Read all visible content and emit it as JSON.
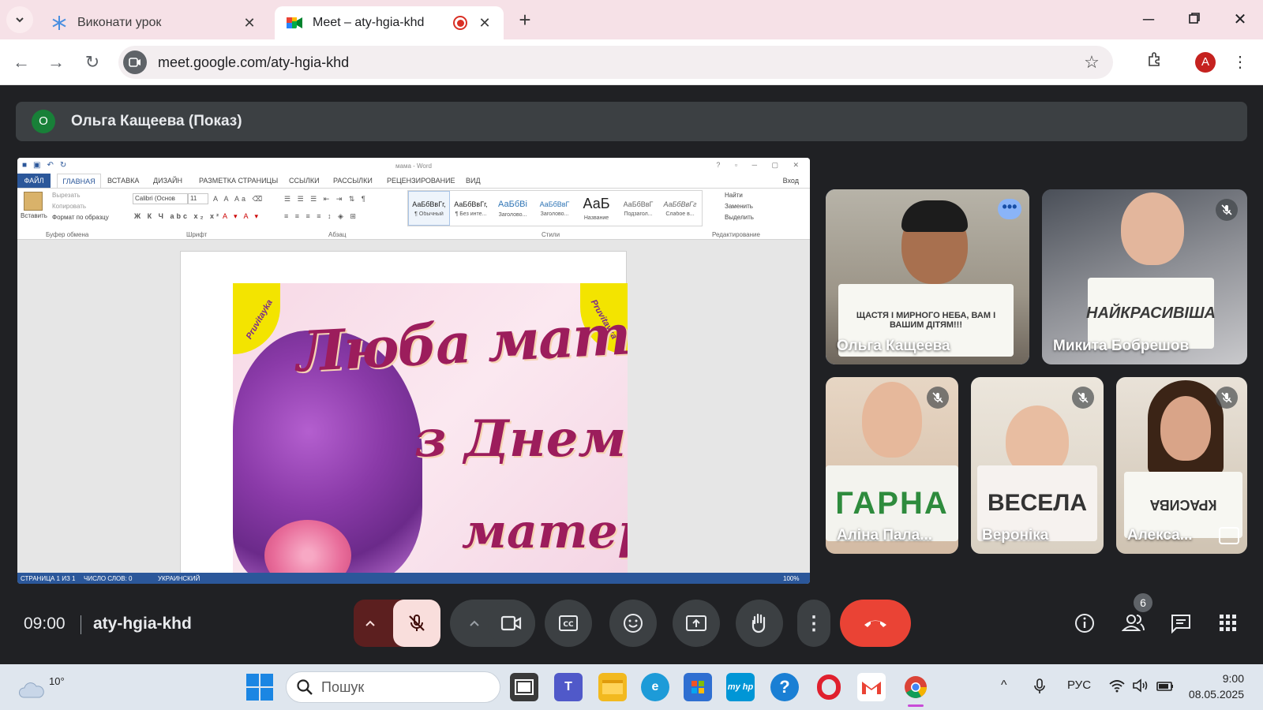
{
  "browser": {
    "tabs": [
      {
        "title": "Виконати урок",
        "active": false
      },
      {
        "title": "Meet – aty-hgia-khd",
        "active": true
      }
    ],
    "url": "meet.google.com/aty-hgia-khd",
    "profile_initial": "A"
  },
  "meet": {
    "presenter": {
      "initial": "О",
      "label": "Ольга Кащеева (Показ)"
    },
    "time": "09:00",
    "meeting_code": "aty-hgia-khd",
    "participant_count": "6",
    "participants": [
      {
        "name": "Ольга Кащеева",
        "sign": "ЩАСТЯ І МИРНОГО НЕБА, ВАМ І ВАШИМ ДІТЯМ!!!"
      },
      {
        "name": "Микита Бобрешов",
        "sign": "НАЙКРАСИВІША"
      },
      {
        "name": "Аліна Пала...",
        "sign": "ГАРНА"
      },
      {
        "name": "Вероніка",
        "sign": "ВЕСЕЛА"
      },
      {
        "name": "Алекса...",
        "sign": "КРАСИВА"
      }
    ]
  },
  "word": {
    "doc_title": "мама - Word",
    "tabs": [
      "ФАЙЛ",
      "ГЛАВНАЯ",
      "ВСТАВКА",
      "ДИЗАЙН",
      "РАЗМЕТКА СТРАНИЦЫ",
      "ССЫЛКИ",
      "РАССЫЛКИ",
      "РЕЦЕНЗИРОВАНИЕ",
      "ВИД"
    ],
    "login": "Вход",
    "clipboard": {
      "paste": "Вставить",
      "cut": "Вырезать",
      "copy": "Копировать",
      "format": "Формат по образцу"
    },
    "font_name": "Calibri (Основ",
    "font_size": "11",
    "groups": [
      "Буфер обмена",
      "Шрифт",
      "Абзац",
      "Стили",
      "Редактирование"
    ],
    "styles": [
      {
        "sample": "АаБбВвГг,",
        "caption": "¶ Обычный"
      },
      {
        "sample": "АаБбВвГг,",
        "caption": "¶ Без инте..."
      },
      {
        "sample": "АаБбВі",
        "caption": "Заголово..."
      },
      {
        "sample": "АаБбВвГ",
        "caption": "Заголово..."
      },
      {
        "sample": "АаБ",
        "caption": "Название"
      },
      {
        "sample": "АаБбВвГ",
        "caption": "Подзагол..."
      },
      {
        "sample": "АаБбВвГг",
        "caption": "Слабое в..."
      }
    ],
    "editing": [
      "Найти",
      "Заменить",
      "Выделить"
    ],
    "greeting": [
      "Люба матусю,",
      "з Днем",
      "матері!"
    ],
    "watermark": "Pruvitayka",
    "status": {
      "page": "СТРАНИЦА 1 ИЗ 1",
      "words": "ЧИСЛО СЛОВ: 0",
      "lang": "УКРАИНСКИЙ",
      "zoom": "100%"
    }
  },
  "taskbar": {
    "temperature": "10°",
    "search_placeholder": "Пошук",
    "language": "РУС",
    "time": "9:00",
    "date": "08.05.2025"
  }
}
